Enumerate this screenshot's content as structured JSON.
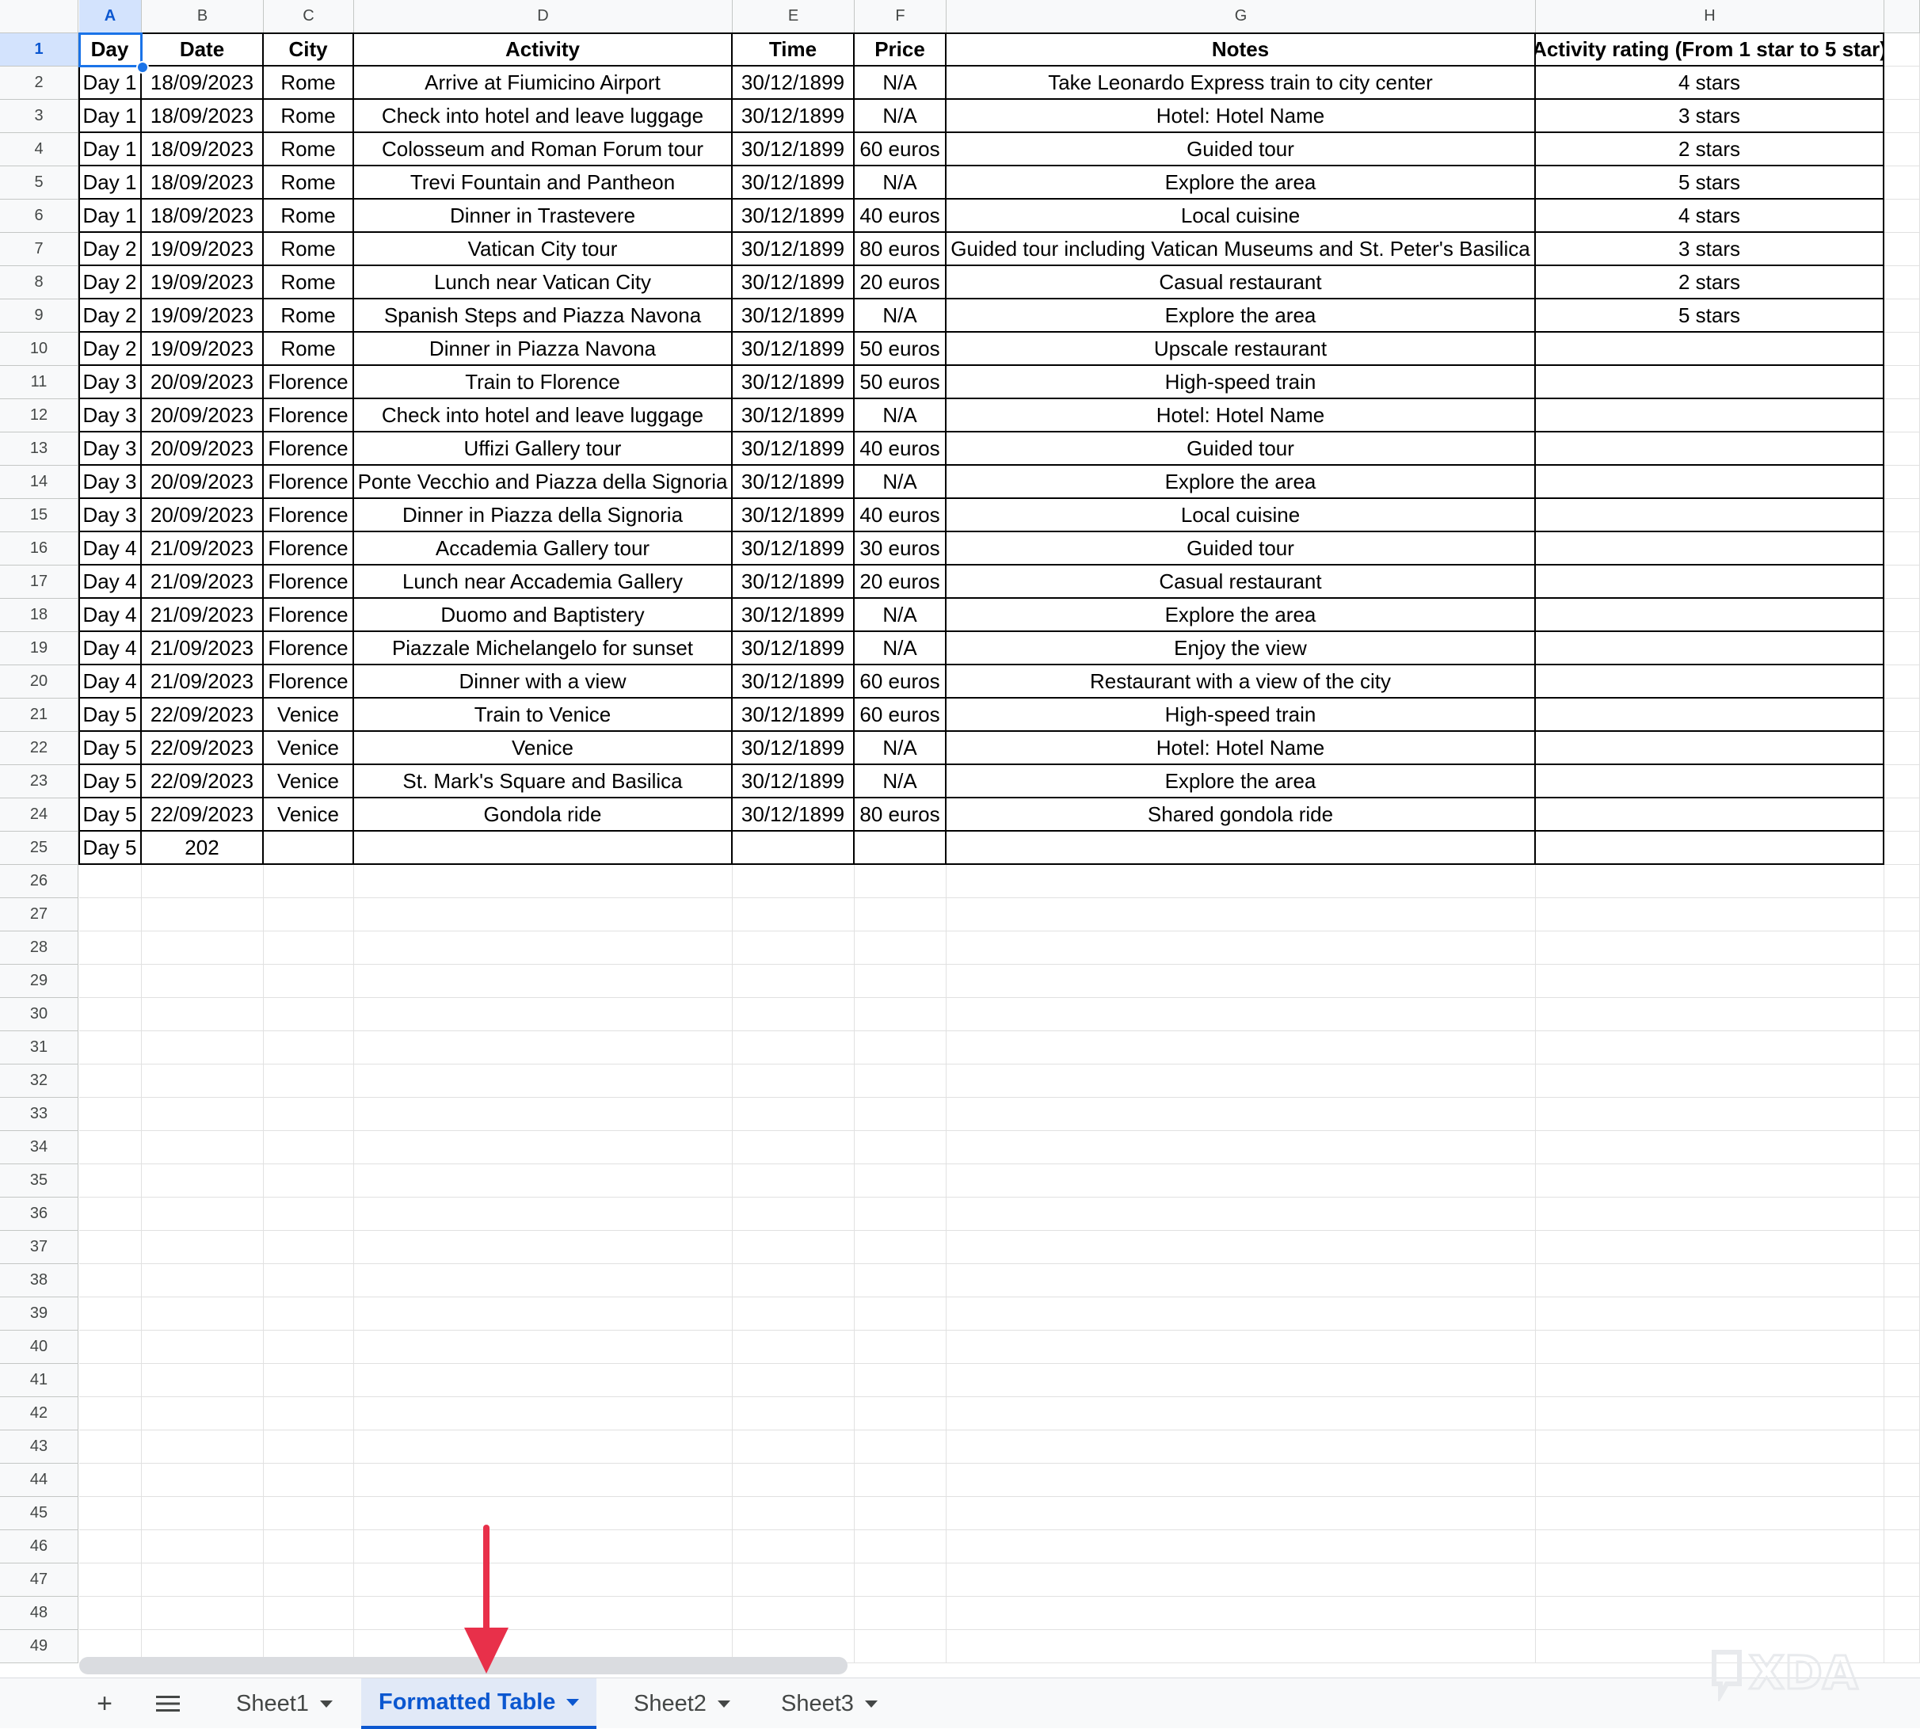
{
  "sheet": {
    "columns": [
      "A",
      "B",
      "C",
      "D",
      "E",
      "F",
      "G",
      "H"
    ],
    "row_count": 49,
    "header": [
      "Day",
      "Date",
      "City",
      "Activity",
      "Time",
      "Price",
      "Notes",
      "Activity rating (From 1 star to 5 star)"
    ],
    "rows": [
      [
        "Day 1",
        "18/09/2023",
        "Rome",
        "Arrive at Fiumicino Airport",
        "30/12/1899",
        "N/A",
        "Take Leonardo Express train to city center",
        "4 stars"
      ],
      [
        "Day 1",
        "18/09/2023",
        "Rome",
        "Check into hotel and leave luggage",
        "30/12/1899",
        "N/A",
        "Hotel: Hotel Name",
        "3 stars"
      ],
      [
        "Day 1",
        "18/09/2023",
        "Rome",
        "Colosseum and Roman Forum tour",
        "30/12/1899",
        "60 euros",
        "Guided tour",
        "2 stars"
      ],
      [
        "Day 1",
        "18/09/2023",
        "Rome",
        "Trevi Fountain and Pantheon",
        "30/12/1899",
        "N/A",
        "Explore the area",
        "5 stars"
      ],
      [
        "Day 1",
        "18/09/2023",
        "Rome",
        "Dinner in Trastevere",
        "30/12/1899",
        "40 euros",
        "Local cuisine",
        "4 stars"
      ],
      [
        "Day 2",
        "19/09/2023",
        "Rome",
        "Vatican City tour",
        "30/12/1899",
        "80 euros",
        "Guided tour including Vatican Museums and St. Peter's Basilica",
        "3 stars"
      ],
      [
        "Day 2",
        "19/09/2023",
        "Rome",
        "Lunch near Vatican City",
        "30/12/1899",
        "20 euros",
        "Casual restaurant",
        "2 stars"
      ],
      [
        "Day 2",
        "19/09/2023",
        "Rome",
        "Spanish Steps and Piazza Navona",
        "30/12/1899",
        "N/A",
        "Explore the area",
        "5 stars"
      ],
      [
        "Day 2",
        "19/09/2023",
        "Rome",
        "Dinner in Piazza Navona",
        "30/12/1899",
        "50 euros",
        "Upscale restaurant",
        ""
      ],
      [
        "Day 3",
        "20/09/2023",
        "Florence",
        "Train to Florence",
        "30/12/1899",
        "50 euros",
        "High-speed train",
        ""
      ],
      [
        "Day 3",
        "20/09/2023",
        "Florence",
        "Check into hotel and leave luggage",
        "30/12/1899",
        "N/A",
        "Hotel: Hotel Name",
        ""
      ],
      [
        "Day 3",
        "20/09/2023",
        "Florence",
        "Uffizi Gallery tour",
        "30/12/1899",
        "40 euros",
        "Guided tour",
        ""
      ],
      [
        "Day 3",
        "20/09/2023",
        "Florence",
        "Ponte Vecchio and Piazza della Signoria",
        "30/12/1899",
        "N/A",
        "Explore the area",
        ""
      ],
      [
        "Day 3",
        "20/09/2023",
        "Florence",
        "Dinner in Piazza della Signoria",
        "30/12/1899",
        "40 euros",
        "Local cuisine",
        ""
      ],
      [
        "Day 4",
        "21/09/2023",
        "Florence",
        "Accademia Gallery tour",
        "30/12/1899",
        "30 euros",
        "Guided tour",
        ""
      ],
      [
        "Day 4",
        "21/09/2023",
        "Florence",
        "Lunch near Accademia Gallery",
        "30/12/1899",
        "20 euros",
        "Casual restaurant",
        ""
      ],
      [
        "Day 4",
        "21/09/2023",
        "Florence",
        "Duomo and Baptistery",
        "30/12/1899",
        "N/A",
        "Explore the area",
        ""
      ],
      [
        "Day 4",
        "21/09/2023",
        "Florence",
        "Piazzale Michelangelo for sunset",
        "30/12/1899",
        "N/A",
        "Enjoy the view",
        ""
      ],
      [
        "Day 4",
        "21/09/2023",
        "Florence",
        "Dinner with a view",
        "30/12/1899",
        "60 euros",
        "Restaurant with a view of the city",
        ""
      ],
      [
        "Day 5",
        "22/09/2023",
        "Venice",
        "Train to Venice",
        "30/12/1899",
        "60 euros",
        "High-speed train",
        ""
      ],
      [
        "Day 5",
        "22/09/2023",
        "Venice",
        "Venice",
        "30/12/1899",
        "N/A",
        "Hotel: Hotel Name",
        ""
      ],
      [
        "Day 5",
        "22/09/2023",
        "Venice",
        "St. Mark's Square and Basilica",
        "30/12/1899",
        "N/A",
        "Explore the area",
        ""
      ],
      [
        "Day 5",
        "22/09/2023",
        "Venice",
        "Gondola ride",
        "30/12/1899",
        "80 euros",
        "Shared gondola ride",
        ""
      ],
      [
        "Day 5",
        "202",
        "",
        "",
        "",
        "",
        "",
        ""
      ]
    ]
  },
  "tabs": {
    "add_icon": "plus-icon",
    "all_sheets_icon": "menu-icon",
    "items": [
      {
        "label": "Sheet1"
      },
      {
        "label": "Formatted Table",
        "active": true
      },
      {
        "label": "Sheet2"
      },
      {
        "label": "Sheet3"
      }
    ]
  },
  "annotation": {
    "arrow_color": "#e8304a"
  },
  "watermark": {
    "text": "XDA"
  },
  "colors": {
    "accent": "#0b57d0",
    "selection": "#1a73e8",
    "header_bg": "#f8f9fa"
  }
}
